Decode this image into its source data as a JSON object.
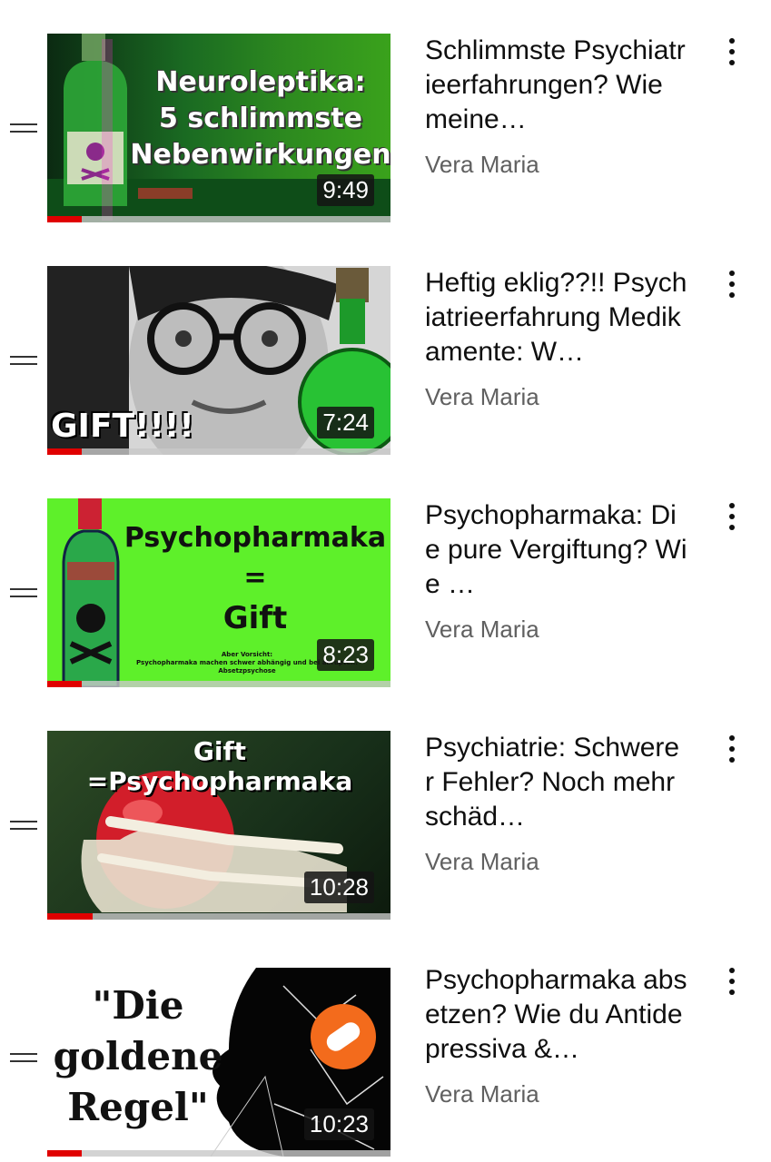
{
  "colors": {
    "progress": "#e00000",
    "title": "#0f0f0f",
    "channel": "#606060"
  },
  "videos": [
    {
      "title": "Schlimmste Psychiatrieerfahrungen? Wie meine…",
      "channel": "Vera Maria",
      "duration": "9:49",
      "thumb_lines": [
        "Neuroleptika:",
        "5 schlimmste",
        "Nebenwirkungen"
      ],
      "progress": 0.1
    },
    {
      "title": "Heftig eklig??!! Psychiatrieerfahrung Medikamente: W…",
      "channel": "Vera Maria",
      "duration": "7:24",
      "thumb_lines": [
        "GIFT!!!!"
      ],
      "progress": 0.1
    },
    {
      "title": "Psychopharmaka: Die pure Vergiftung? Wie …",
      "channel": "Vera Maria",
      "duration": "8:23",
      "thumb_lines": [
        "Psychopharmaka",
        "=",
        "Gift",
        "Aber Vorsicht:",
        "Psychopharmaka machen schwer abhängig und bei abrupte...",
        "Absetzpsychose"
      ],
      "progress": 0.1
    },
    {
      "title": "Psychiatrie: Schwerer Fehler? Noch mehr schäd…",
      "channel": "Vera Maria",
      "duration": "10:28",
      "thumb_lines": [
        "Gift =Psychopharmaka"
      ],
      "progress": 0.13
    },
    {
      "title": "Psychopharmaka absetzen? Wie du Antidepressiva &…",
      "channel": "Vera Maria",
      "duration": "10:23",
      "thumb_lines": [
        "\"Die",
        "goldene",
        "Regel\""
      ],
      "progress": 0.1
    }
  ]
}
